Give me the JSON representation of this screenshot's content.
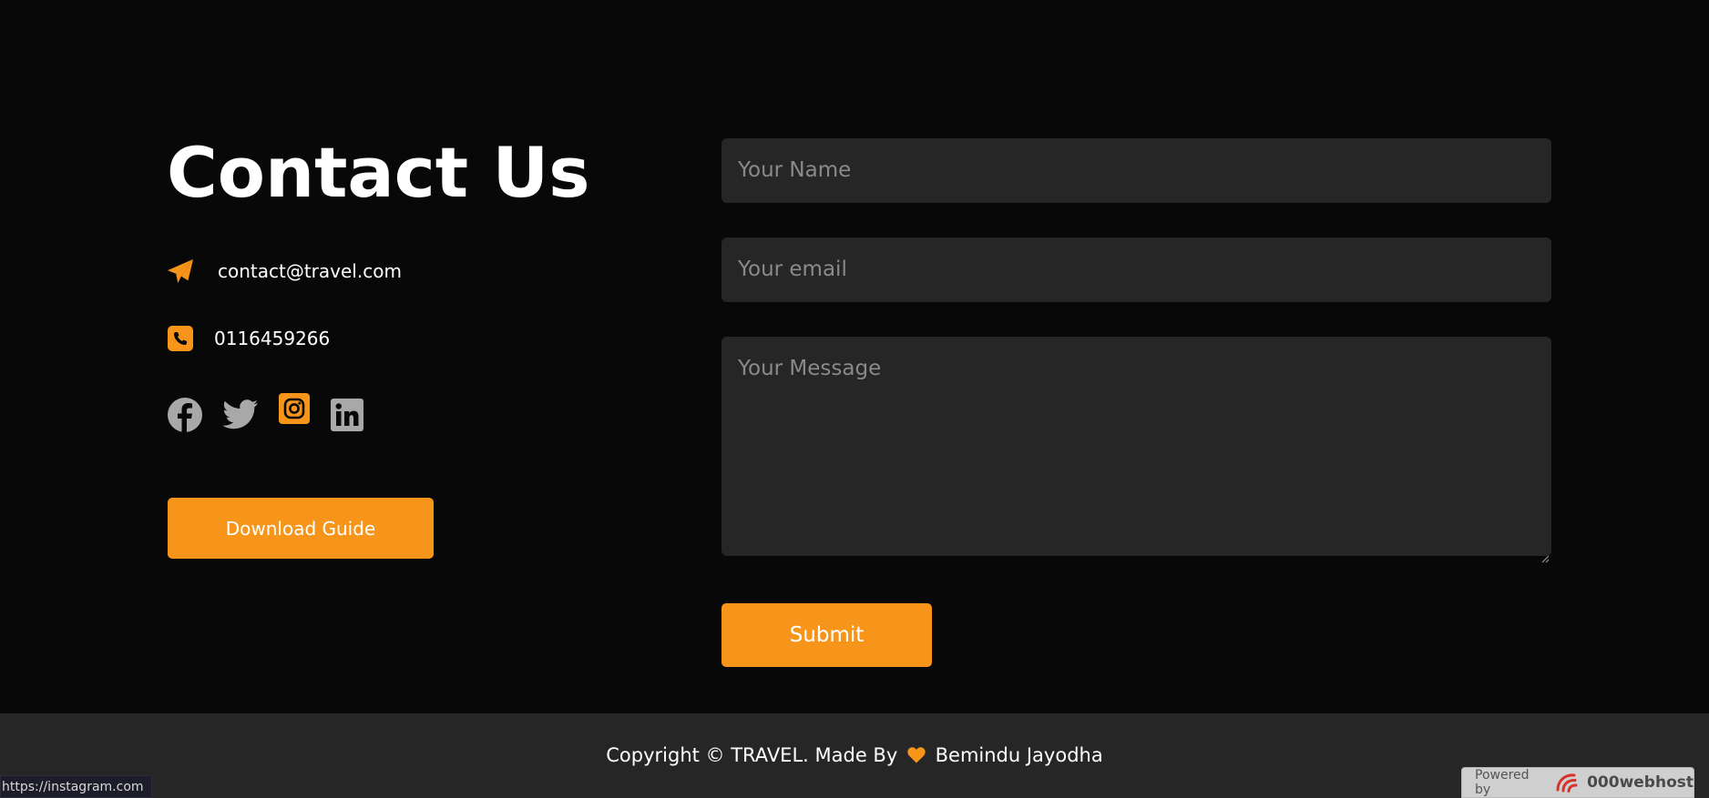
{
  "contact": {
    "title": "Contact Us",
    "email": "contact@travel.com",
    "phone": "0116459266",
    "download_label": "Download Guide"
  },
  "icons": {
    "email": "paper-plane-icon",
    "phone": "phone-square-icon",
    "social": [
      "facebook-icon",
      "twitter-icon",
      "instagram-icon",
      "linkedin-icon"
    ]
  },
  "form": {
    "name_placeholder": "Your Name",
    "email_placeholder": "Your email",
    "message_placeholder": "Your Message",
    "submit_label": "Submit"
  },
  "footer": {
    "copyright_prefix": "Copyright © TRAVEL. Made By",
    "author": "Bemindu Jayodha"
  },
  "status_bar": {
    "url": "https://instagram.com"
  },
  "badge": {
    "powered_by": "Powered by",
    "brand": "000webhost"
  },
  "colors": {
    "background": "#080808",
    "accent": "#f7951b",
    "field_bg": "#262626",
    "footer_bg": "#262626",
    "social_gray": "#a8a8a8"
  }
}
